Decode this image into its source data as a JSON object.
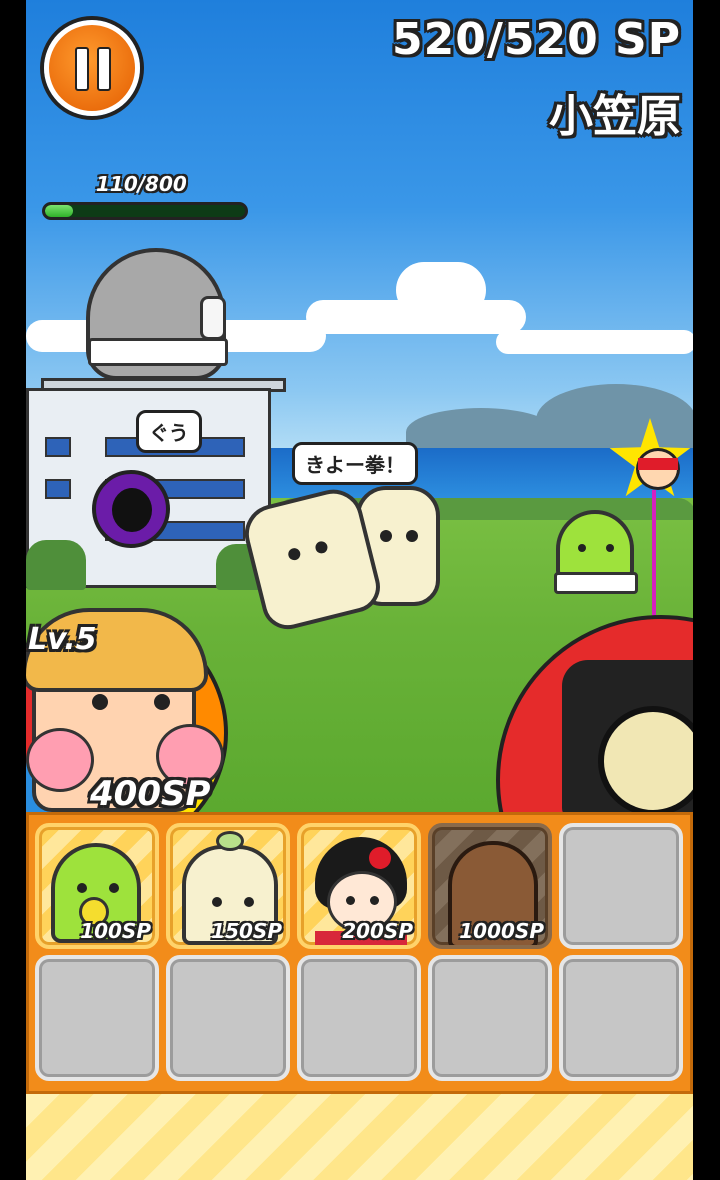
{
  "hud": {
    "sp_current": "520",
    "sp_max": "520",
    "sp_display": "520/520 SP",
    "stage_name": "小笠原",
    "enemy_base_hp": "110/800",
    "enemy_base_hp_fraction": 0.1375
  },
  "speech": {
    "enemy": "ぐう",
    "ally": "きよー拳！"
  },
  "player_base": {
    "level": "Lv.5",
    "upgrade_cost": "400SP"
  },
  "units": [
    {
      "name": "green-baby-unit",
      "cost": "100SP",
      "state": "available"
    },
    {
      "name": "mochi-unit",
      "cost": "150SP",
      "state": "available"
    },
    {
      "name": "geisha-unit",
      "cost": "200SP",
      "state": "available"
    },
    {
      "name": "moai-unit",
      "cost": "1000SP",
      "state": "unaffordable"
    }
  ],
  "empty_slots": 6,
  "colors": {
    "panel": "#f28c1a",
    "pause_button": "#ff7a10",
    "hp_fill": "#2fb12a"
  }
}
